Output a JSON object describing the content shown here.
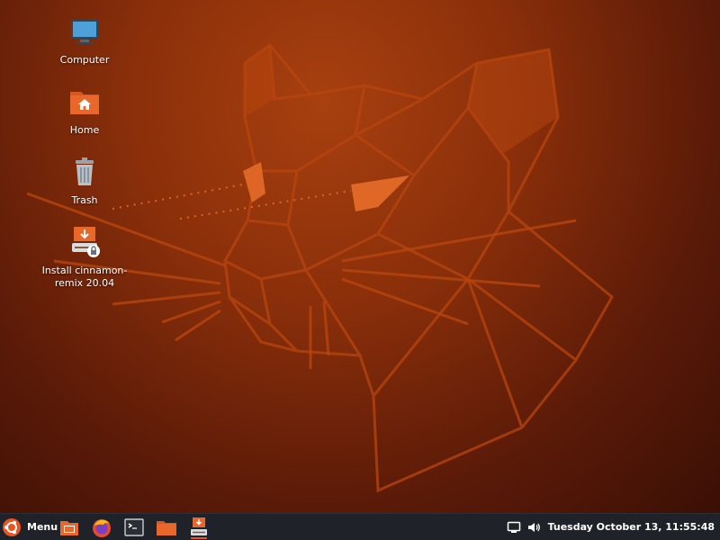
{
  "desktop": {
    "icons": [
      {
        "label": "Computer",
        "icon": "computer-icon"
      },
      {
        "label": "Home",
        "icon": "home-folder-icon"
      },
      {
        "label": "Trash",
        "icon": "trash-icon"
      },
      {
        "label": "Install cinnamon-remix 20.04",
        "icon": "installer-icon"
      }
    ],
    "wallpaper": "ubuntu-cat-wallpaper"
  },
  "taskbar": {
    "menu_label": "Menu",
    "launchers": [
      {
        "name": "show-desktop",
        "icon": "show-desktop-icon"
      },
      {
        "name": "firefox",
        "icon": "firefox-icon"
      },
      {
        "name": "terminal",
        "icon": "terminal-icon"
      },
      {
        "name": "files",
        "icon": "folder-icon"
      },
      {
        "name": "installer",
        "icon": "installer-icon",
        "active": true
      }
    ],
    "tray": {
      "network_icon": "network-icon",
      "volume_icon": "volume-icon",
      "clock": "Tuesday October 13, 11:55:48"
    }
  },
  "colors": {
    "accent": "#e95420",
    "panel": "#1f2329",
    "wallpaper_base": "#8a2f0a"
  }
}
